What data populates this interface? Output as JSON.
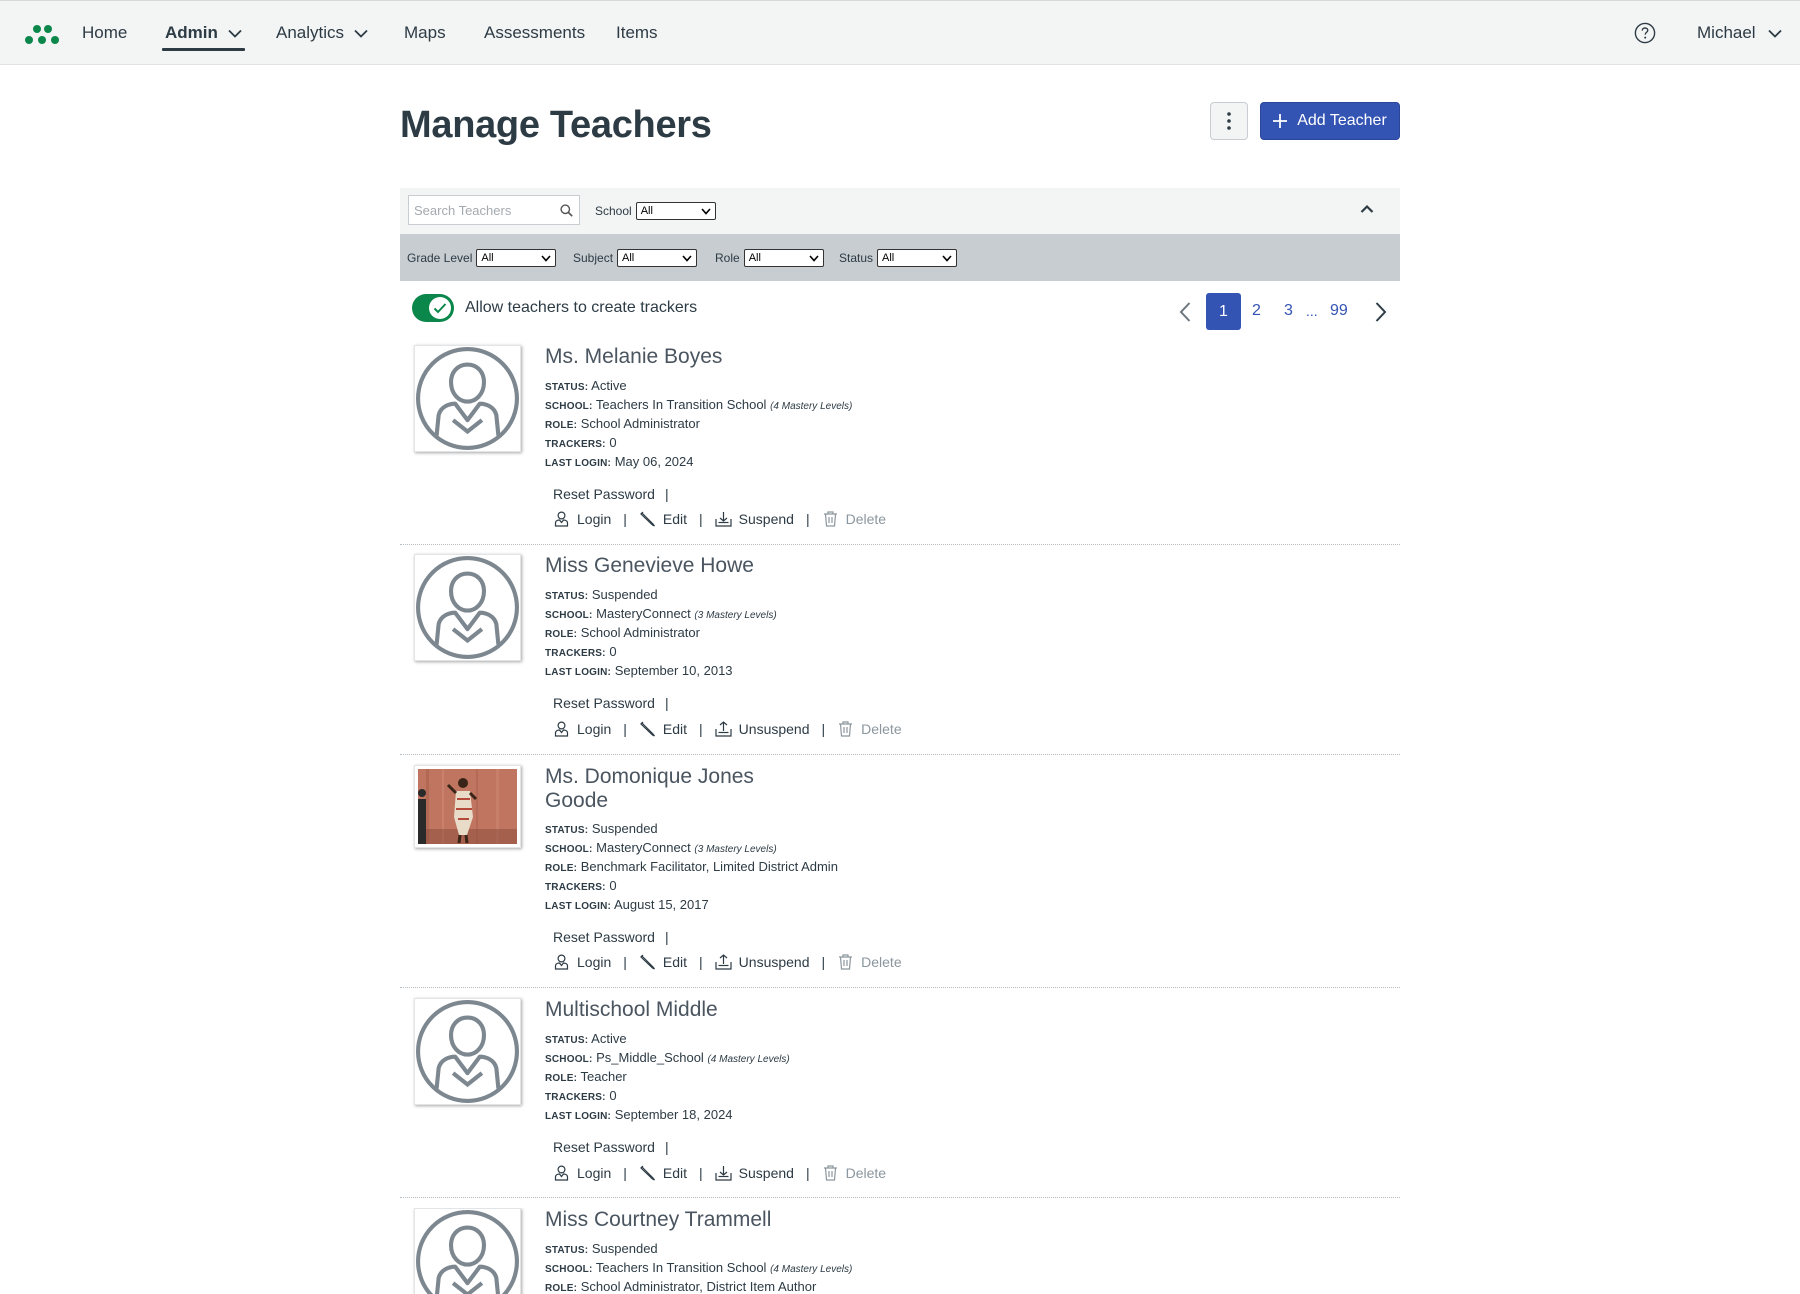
{
  "nav": {
    "items": [
      {
        "label": "Home"
      },
      {
        "label": "Admin",
        "active": true,
        "dropdown": true
      },
      {
        "label": "Analytics",
        "dropdown": true
      },
      {
        "label": "Maps"
      },
      {
        "label": "Assessments"
      },
      {
        "label": "Items"
      }
    ],
    "user_label": "Michael",
    "brand_color": "#0b874b"
  },
  "header": {
    "title": "Manage Teachers",
    "add_button_label": "Add Teacher",
    "accent": "#3454b4"
  },
  "filters": {
    "search_placeholder": "Search Teachers",
    "school_label": "School",
    "school_value": "All",
    "grade_label": "Grade Level",
    "grade_value": "All",
    "subject_label": "Subject",
    "subject_value": "All",
    "role_label": "Role",
    "role_value": "All",
    "status_label": "Status",
    "status_value": "All"
  },
  "toggle": {
    "label": "Allow teachers to create trackers",
    "on": true
  },
  "pagination": {
    "current": "1",
    "pages": [
      "2",
      "3"
    ],
    "ellipsis": "...",
    "last": "99"
  },
  "labels": {
    "status": "STATUS:",
    "school": "SCHOOL:",
    "role": "ROLE:",
    "trackers": "TRACKERS:",
    "last_login": "LAST LOGIN:",
    "reset_password": "Reset Password",
    "login": "Login",
    "edit": "Edit",
    "delete": "Delete",
    "sep": "|"
  },
  "teachers": [
    {
      "name": "Ms. Melanie Boyes",
      "status": "Active",
      "school": "Teachers In Transition School",
      "mastery": "(4 Mastery Levels)",
      "role": "School Administrator",
      "trackers": "0",
      "last_login": "May 06, 2024",
      "toggle_action": "Suspend"
    },
    {
      "name": "Miss Genevieve Howe",
      "status": "Suspended",
      "school": "MasteryConnect",
      "mastery": "(3 Mastery Levels)",
      "role": "School Administrator",
      "trackers": "0",
      "last_login": "September 10, 2013",
      "toggle_action": "Unsuspend"
    },
    {
      "name": "Ms. Domonique Jones Goode",
      "status": "Suspended",
      "school": "MasteryConnect",
      "mastery": "(3 Mastery Levels)",
      "role": "Benchmark Facilitator, Limited District Admin",
      "trackers": "0",
      "last_login": "August 15, 2017",
      "toggle_action": "Unsuspend"
    },
    {
      "name": "Multischool Middle",
      "status": "Active",
      "school": "Ps_Middle_School",
      "mastery": "(4 Mastery Levels)",
      "role": "Teacher",
      "trackers": "0",
      "last_login": "September 18, 2024",
      "toggle_action": "Suspend"
    },
    {
      "name": "Miss Courtney Trammell",
      "status": "Suspended",
      "school": "Teachers In Transition School",
      "mastery": "(4 Mastery Levels)",
      "role": "School Administrator, District Item Author"
    }
  ]
}
